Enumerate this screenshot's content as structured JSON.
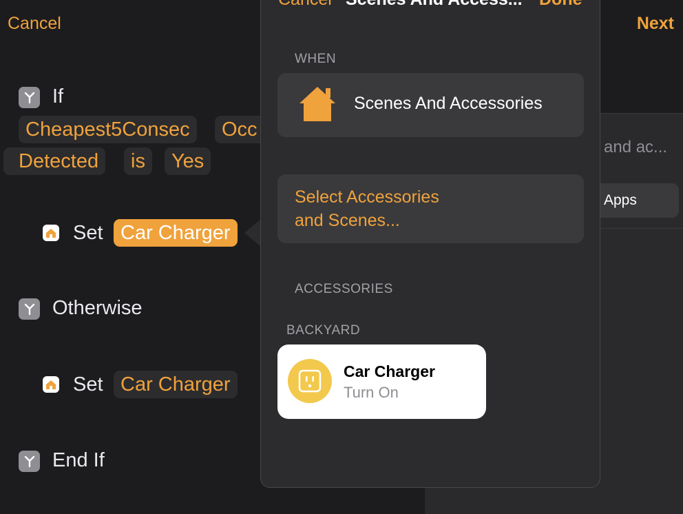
{
  "editor": {
    "cancel_label": "Cancel",
    "next_label": "Next",
    "if_label": "If",
    "tokens_row1": [
      "Cheapest5Consec",
      "Occ"
    ],
    "tokens_row2": [
      "Detected",
      "is",
      "Yes"
    ],
    "set_label": "Set",
    "selected_accessory": "Car Charger",
    "otherwise_label": "Otherwise",
    "accessory_2": "Car Charger",
    "end_if_label": "End If"
  },
  "side_panel": {
    "search_text": "and ac...",
    "apps_label": "Apps"
  },
  "popover": {
    "cancel_label": "Cancel",
    "title": "Scenes And Access...",
    "done_label": "Done",
    "when_header": "WHEN",
    "when_item": "Scenes And Accessories",
    "select_line1": "Select Accessories",
    "select_line2": "and Scenes...",
    "accessories_header": "ACCESSORIES",
    "room_header": "BACKYARD",
    "accessory": {
      "name": "Car Charger",
      "state": "Turn On",
      "icon": "outlet-icon"
    }
  },
  "colors": {
    "accent": "#f0a23c",
    "background": "#1c1c1e",
    "card": "#3a3a3c",
    "outlet_yellow": "#f2c94c"
  }
}
